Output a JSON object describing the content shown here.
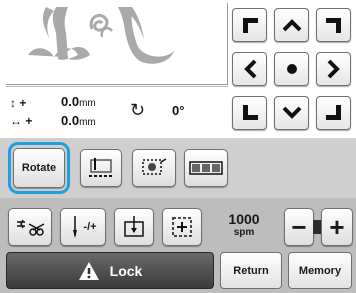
{
  "position": {
    "y_symbol": "↕ +",
    "x_symbol": "↔ +",
    "y_value": "0.0",
    "y_unit": "mm",
    "x_value": "0.0",
    "x_unit": "mm"
  },
  "rotation": {
    "symbol": "↻",
    "value": "0°"
  },
  "toolbar": {
    "rotate_label": "Rotate"
  },
  "speed": {
    "value": "1000",
    "unit": "spm",
    "minus_label": "−",
    "plus_label": "+"
  },
  "bottom": {
    "lock_label": "Lock",
    "return_label": "Return",
    "memory_label": "Memory"
  },
  "lower_toolbar": {
    "thread_adjust_label": "-/+"
  },
  "colors": {
    "highlight": "#1ea0e0",
    "toolbar_bg": "#cfcfcf",
    "lower_bg": "#bdbdbd",
    "lock_bg": "#4a4a4a"
  }
}
